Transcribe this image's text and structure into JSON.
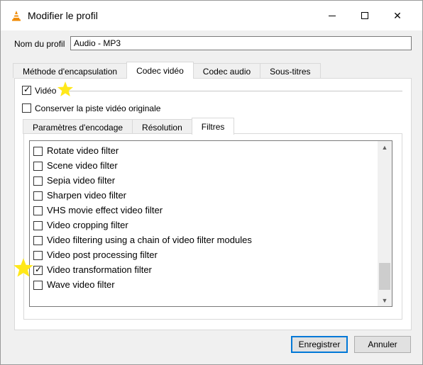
{
  "window": {
    "title": "Modifier le profil",
    "icon": "vlc-cone-icon",
    "close_glyph": "✕"
  },
  "profile": {
    "name_label": "Nom du profil",
    "name_value": "Audio - MP3"
  },
  "tabs": [
    {
      "label": "Méthode d'encapsulation",
      "active": false
    },
    {
      "label": "Codec vidéo",
      "active": true
    },
    {
      "label": "Codec audio",
      "active": false
    },
    {
      "label": "Sous-titres",
      "active": false
    }
  ],
  "video": {
    "enable_label": "Vidéo",
    "enable_checked": true,
    "keep_original_label": "Conserver la piste vidéo originale",
    "keep_original_checked": false
  },
  "subtabs": [
    {
      "label": "Paramètres d'encodage",
      "active": false
    },
    {
      "label": "Résolution",
      "active": false
    },
    {
      "label": "Filtres",
      "active": true
    }
  ],
  "filters": [
    {
      "label": "Rotate video filter",
      "checked": false
    },
    {
      "label": "Scene video filter",
      "checked": false
    },
    {
      "label": "Sepia video filter",
      "checked": false
    },
    {
      "label": "Sharpen video filter",
      "checked": false
    },
    {
      "label": "VHS movie effect video filter",
      "checked": false
    },
    {
      "label": "Video cropping filter",
      "checked": false
    },
    {
      "label": "Video filtering using a chain of video filter modules",
      "checked": false
    },
    {
      "label": "Video post processing filter",
      "checked": false
    },
    {
      "label": "Video transformation filter",
      "checked": true
    },
    {
      "label": "Wave video filter",
      "checked": false
    }
  ],
  "check_glyph": "✓",
  "scroll": {
    "up_glyph": "▲",
    "down_glyph": "▼"
  },
  "buttons": {
    "save": "Enregistrer",
    "cancel": "Annuler"
  },
  "colors": {
    "accent": "#0078d7",
    "star": "#ffe81a",
    "vlc_orange": "#f08a00"
  }
}
